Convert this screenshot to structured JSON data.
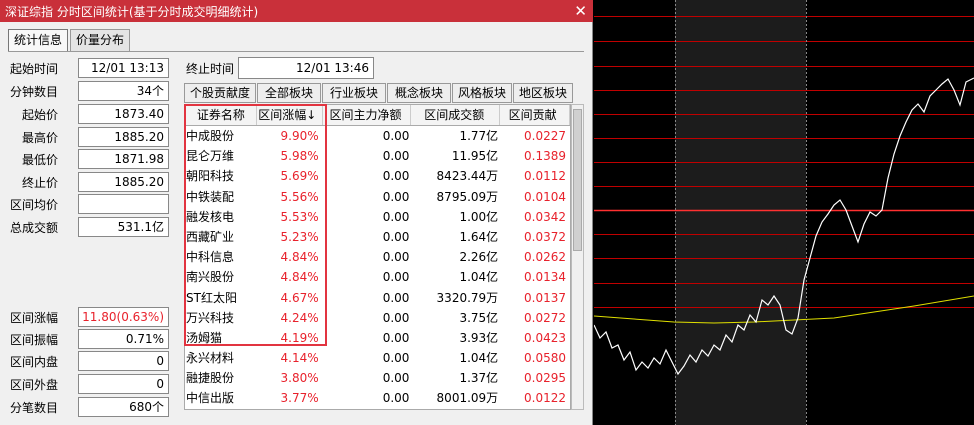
{
  "title": "深证综指 分时区间统计(基于分时成交明细统计)",
  "close_glyph": "✕",
  "tabs": [
    "统计信息",
    "价量分布"
  ],
  "stats_top": [
    {
      "label": "起始时间",
      "value": "12/01 13:13"
    },
    {
      "label": "分钟数目",
      "value": "34个"
    },
    {
      "label": "起始价",
      "value": "1873.40"
    },
    {
      "label": "最高价",
      "value": "1885.20"
    },
    {
      "label": "最低价",
      "value": "1871.98"
    },
    {
      "label": "终止价",
      "value": "1885.20"
    },
    {
      "label": "区间均价",
      "value": ""
    },
    {
      "label": "总成交额",
      "value": "531.1亿"
    }
  ],
  "stats_bottom": [
    {
      "label": "区间涨幅",
      "value": "11.80(0.63%)"
    },
    {
      "label": "区间振幅",
      "value": "0.71%"
    },
    {
      "label": "区间内盘",
      "value": "0"
    },
    {
      "label": "区间外盘",
      "value": "0"
    },
    {
      "label": "分笔数目",
      "value": "680个"
    }
  ],
  "end_time": {
    "label": "终止时间",
    "value": "12/01 13:46"
  },
  "board_tabs": [
    "个股贡献度",
    "全部板块",
    "行业板块",
    "概念板块",
    "风格板块",
    "地区板块"
  ],
  "columns": [
    "证券名称",
    "区间涨幅↓",
    "区间主力净额",
    "区间成交额",
    "区间贡献"
  ],
  "rows": [
    [
      "中成股份",
      "9.90%",
      "0.00",
      "1.77亿",
      "0.0227"
    ],
    [
      "昆仑万维",
      "5.98%",
      "0.00",
      "11.95亿",
      "0.1389"
    ],
    [
      "朝阳科技",
      "5.69%",
      "0.00",
      "8423.44万",
      "0.0112"
    ],
    [
      "中铁装配",
      "5.56%",
      "0.00",
      "8795.09万",
      "0.0104"
    ],
    [
      "融发核电",
      "5.53%",
      "0.00",
      "1.00亿",
      "0.0342"
    ],
    [
      "西藏矿业",
      "5.23%",
      "0.00",
      "1.64亿",
      "0.0372"
    ],
    [
      "中科信息",
      "4.84%",
      "0.00",
      "2.26亿",
      "0.0262"
    ],
    [
      "南兴股份",
      "4.84%",
      "0.00",
      "1.04亿",
      "0.0134"
    ],
    [
      "ST红太阳",
      "4.67%",
      "0.00",
      "3320.79万",
      "0.0137"
    ],
    [
      "万兴科技",
      "4.24%",
      "0.00",
      "3.75亿",
      "0.0272"
    ],
    [
      "汤姆猫",
      "4.19%",
      "0.00",
      "3.93亿",
      "0.0423"
    ],
    [
      "永兴材料",
      "4.14%",
      "0.00",
      "1.04亿",
      "0.0580"
    ],
    [
      "融捷股份",
      "3.80%",
      "0.00",
      "1.37亿",
      "0.0295"
    ],
    [
      "中信出版",
      "3.77%",
      "0.00",
      "8001.09万",
      "0.0122"
    ]
  ],
  "colors": {
    "accent_red": "#e8222c",
    "titlebar": "#c9303a",
    "chart_bg": "#000000",
    "grid_red": "#c00000",
    "price_line": "#ffffff",
    "avg_line": "#e0e000"
  }
}
